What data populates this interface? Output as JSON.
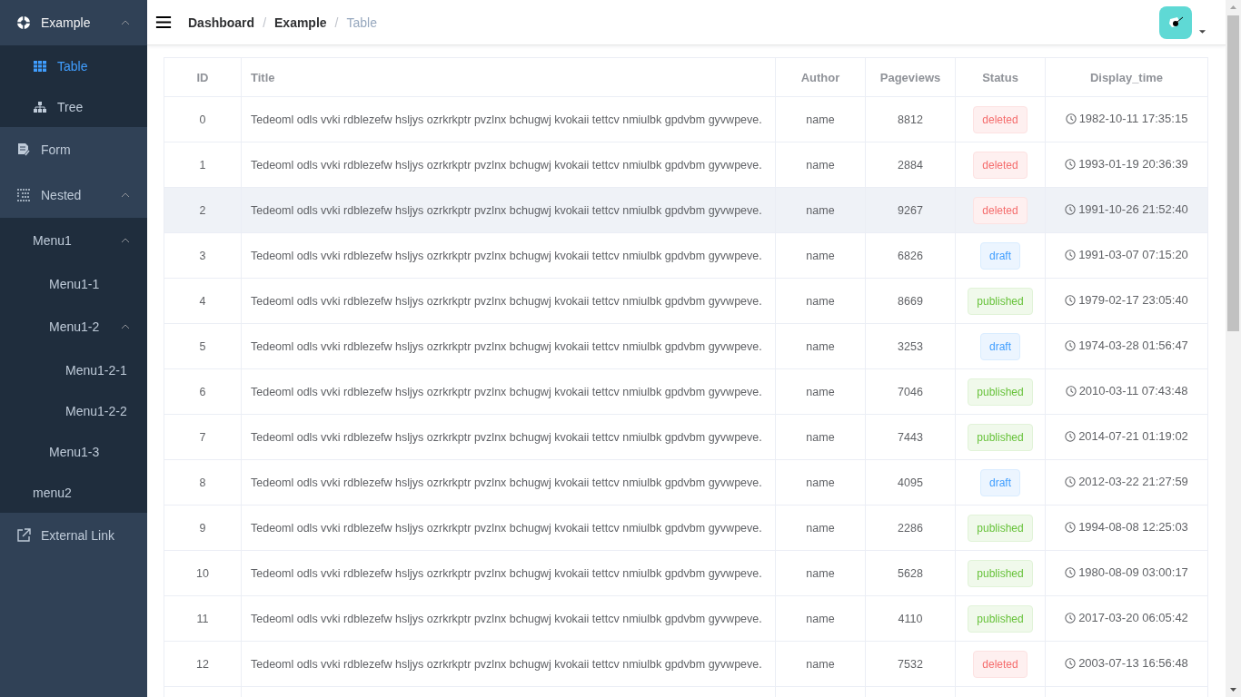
{
  "sidebar": {
    "items": [
      {
        "label": "Example",
        "expanded": true,
        "selected": false,
        "children": [
          {
            "label": "Table",
            "selected": true
          },
          {
            "label": "Tree",
            "selected": false
          }
        ]
      },
      {
        "label": "Form",
        "selected": false
      },
      {
        "label": "Nested",
        "expanded": true,
        "selected": false,
        "children": [
          {
            "label": "Menu1",
            "expanded": true,
            "selected": false,
            "children": [
              {
                "label": "Menu1-1",
                "selected": false
              },
              {
                "label": "Menu1-2",
                "expanded": true,
                "selected": false,
                "children": [
                  {
                    "label": "Menu1-2-1",
                    "selected": false
                  },
                  {
                    "label": "Menu1-2-2",
                    "selected": false
                  }
                ]
              },
              {
                "label": "Menu1-3",
                "selected": false
              }
            ]
          },
          {
            "label": "menu2",
            "selected": false
          }
        ]
      },
      {
        "label": "External Link",
        "selected": false
      }
    ]
  },
  "breadcrumb": [
    {
      "label": "Dashboard",
      "current": false
    },
    {
      "separator": "/",
      "label": "Example",
      "current": false
    },
    {
      "separator": "/",
      "label": "Table",
      "current": true
    }
  ],
  "table": {
    "columns": [
      "ID",
      "Title",
      "Author",
      "Pageviews",
      "Status",
      "Display_time"
    ],
    "rows": [
      {
        "id": "0",
        "title": "Tedeoml odls vvki rdblezefw hsljys ozrkrkptr pvzlnx bchugwj kvokaii tettcv nmiulbk gpdvbm gyvwpeve.",
        "author": "name",
        "pageviews": "8812",
        "status": "deleted",
        "display_time": "1982-10-11 17:35:15",
        "hovered": false
      },
      {
        "id": "1",
        "title": "Tedeoml odls vvki rdblezefw hsljys ozrkrkptr pvzlnx bchugwj kvokaii tettcv nmiulbk gpdvbm gyvwpeve.",
        "author": "name",
        "pageviews": "2884",
        "status": "deleted",
        "display_time": "1993-01-19 20:36:39",
        "hovered": false
      },
      {
        "id": "2",
        "title": "Tedeoml odls vvki rdblezefw hsljys ozrkrkptr pvzlnx bchugwj kvokaii tettcv nmiulbk gpdvbm gyvwpeve.",
        "author": "name",
        "pageviews": "9267",
        "status": "deleted",
        "display_time": "1991-10-26 21:52:40",
        "hovered": true
      },
      {
        "id": "3",
        "title": "Tedeoml odls vvki rdblezefw hsljys ozrkrkptr pvzlnx bchugwj kvokaii tettcv nmiulbk gpdvbm gyvwpeve.",
        "author": "name",
        "pageviews": "6826",
        "status": "draft",
        "display_time": "1991-03-07 07:15:20",
        "hovered": false
      },
      {
        "id": "4",
        "title": "Tedeoml odls vvki rdblezefw hsljys ozrkrkptr pvzlnx bchugwj kvokaii tettcv nmiulbk gpdvbm gyvwpeve.",
        "author": "name",
        "pageviews": "8669",
        "status": "published",
        "display_time": "1979-02-17 23:05:40",
        "hovered": false
      },
      {
        "id": "5",
        "title": "Tedeoml odls vvki rdblezefw hsljys ozrkrkptr pvzlnx bchugwj kvokaii tettcv nmiulbk gpdvbm gyvwpeve.",
        "author": "name",
        "pageviews": "3253",
        "status": "draft",
        "display_time": "1974-03-28 01:56:47",
        "hovered": false
      },
      {
        "id": "6",
        "title": "Tedeoml odls vvki rdblezefw hsljys ozrkrkptr pvzlnx bchugwj kvokaii tettcv nmiulbk gpdvbm gyvwpeve.",
        "author": "name",
        "pageviews": "7046",
        "status": "published",
        "display_time": "2010-03-11 07:43:48",
        "hovered": false
      },
      {
        "id": "7",
        "title": "Tedeoml odls vvki rdblezefw hsljys ozrkrkptr pvzlnx bchugwj kvokaii tettcv nmiulbk gpdvbm gyvwpeve.",
        "author": "name",
        "pageviews": "7443",
        "status": "published",
        "display_time": "2014-07-21 01:19:02",
        "hovered": false
      },
      {
        "id": "8",
        "title": "Tedeoml odls vvki rdblezefw hsljys ozrkrkptr pvzlnx bchugwj kvokaii tettcv nmiulbk gpdvbm gyvwpeve.",
        "author": "name",
        "pageviews": "4095",
        "status": "draft",
        "display_time": "2012-03-22 21:27:59",
        "hovered": false
      },
      {
        "id": "9",
        "title": "Tedeoml odls vvki rdblezefw hsljys ozrkrkptr pvzlnx bchugwj kvokaii tettcv nmiulbk gpdvbm gyvwpeve.",
        "author": "name",
        "pageviews": "2286",
        "status": "published",
        "display_time": "1994-08-08 12:25:03",
        "hovered": false
      },
      {
        "id": "10",
        "title": "Tedeoml odls vvki rdblezefw hsljys ozrkrkptr pvzlnx bchugwj kvokaii tettcv nmiulbk gpdvbm gyvwpeve.",
        "author": "name",
        "pageviews": "5628",
        "status": "published",
        "display_time": "1980-08-09 03:00:17",
        "hovered": false
      },
      {
        "id": "11",
        "title": "Tedeoml odls vvki rdblezefw hsljys ozrkrkptr pvzlnx bchugwj kvokaii tettcv nmiulbk gpdvbm gyvwpeve.",
        "author": "name",
        "pageviews": "4110",
        "status": "published",
        "display_time": "2017-03-20 06:05:42",
        "hovered": false
      },
      {
        "id": "12",
        "title": "Tedeoml odls vvki rdblezefw hsljys ozrkrkptr pvzlnx bchugwj kvokaii tettcv nmiulbk gpdvbm gyvwpeve.",
        "author": "name",
        "pageviews": "7532",
        "status": "deleted",
        "display_time": "2003-07-13 16:56:48",
        "hovered": false
      }
    ]
  }
}
